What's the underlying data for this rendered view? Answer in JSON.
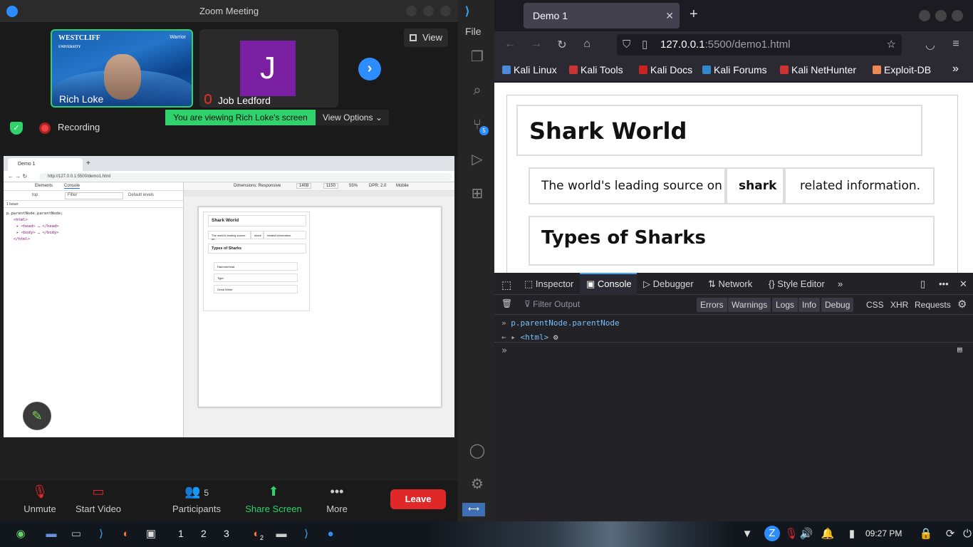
{
  "zoom": {
    "title": "Zoom Meeting",
    "view_label": "View",
    "participants": [
      {
        "name": "Rich Loke"
      },
      {
        "name": "Job Ledford",
        "initial": "J"
      }
    ],
    "tile_brand": "WESTCLIFF",
    "tile_brand_sub": "UNIVERSITY",
    "tile_brand_right": "Warrior",
    "recording_label": "Recording",
    "viewing_banner": "You are viewing Rich Loke's screen",
    "view_options": "View Options",
    "toolbar": {
      "unmute": "Unmute",
      "start_video": "Start Video",
      "participants": "Participants",
      "participants_count": "5",
      "share_screen": "Share Screen",
      "more": "More",
      "leave": "Leave"
    },
    "shared": {
      "tab_title": "Demo 1",
      "url": "http://127.0.0.1:5500/demo1.html",
      "dt_tabs": [
        "Elements",
        "Console"
      ],
      "dt_top": "top",
      "dt_filter": "Filter",
      "dt_levels": "Default levels",
      "dt_issue": "1 Issue:",
      "dt_code": [
        "p.parentNode.parentNode;",
        "<html>",
        "▸ <head> … </head>",
        "▸ <body> … </body>",
        "</html>"
      ],
      "vp_dimensions": "Dimensions: Responsive",
      "vp_w": "1408",
      "vp_h": "1150",
      "vp_zoom": "55%",
      "vp_dpr": "DPR: 2.0",
      "vp_mobile": "Mobile",
      "mini_title": "Shark World",
      "mini_row": [
        "The world's leading source on",
        "shark",
        "related information."
      ],
      "mini_types": "Types of Sharks",
      "mini_list": [
        "Hammerhead",
        "Tiger",
        "Great White"
      ]
    }
  },
  "vscode": {
    "file_menu": "File",
    "scm_badge": "5"
  },
  "firefox": {
    "tab_title": "Demo 1",
    "url_host": "127.0.0.1",
    "url_rest": ":5500/demo1.html",
    "bookmarks": [
      "Kali Linux",
      "Kali Tools",
      "Kali Docs",
      "Kali Forums",
      "Kali NetHunter",
      "Exploit-DB"
    ],
    "page": {
      "h1": "Shark World",
      "row": [
        "The world's leading source on",
        "shark",
        "related information."
      ],
      "h2": "Types of Sharks"
    },
    "devtools": {
      "tabs": [
        "Inspector",
        "Console",
        "Debugger",
        "Network",
        "Style Editor"
      ],
      "filter_placeholder": "Filter Output",
      "levels": [
        "Errors",
        "Warnings",
        "Logs",
        "Info",
        "Debug"
      ],
      "types": [
        "CSS",
        "XHR",
        "Requests"
      ],
      "input_line": "p.parentNode.parentNode",
      "result": "<html>"
    }
  },
  "taskbar": {
    "workspaces": [
      "1",
      "2",
      "3"
    ],
    "firefox_count": "2",
    "clock": "09:27 PM"
  },
  "colors": {
    "zoom_green": "#2fd26b",
    "zoom_blue": "#2d8cff",
    "leave_red": "#e02828",
    "ff_accent": "#3ea6ff"
  }
}
